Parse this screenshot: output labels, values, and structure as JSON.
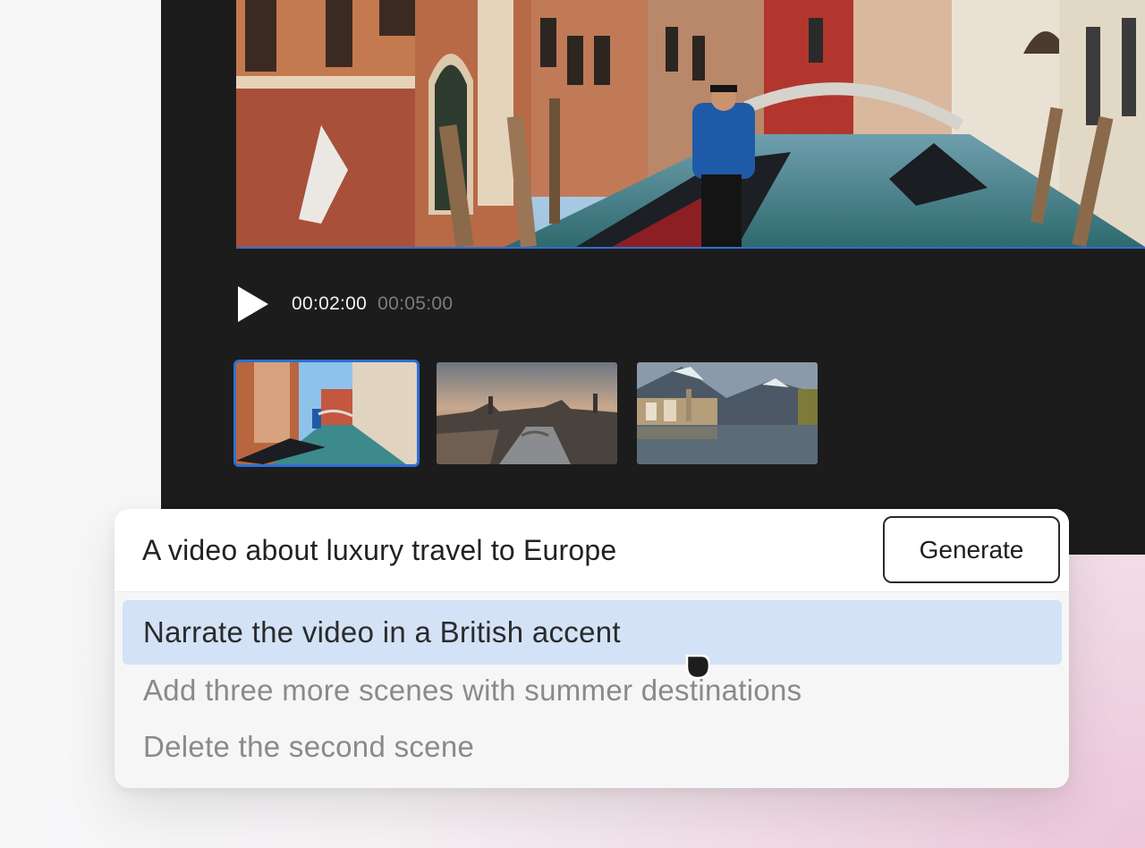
{
  "player": {
    "current_time": "00:02:00",
    "total_time": "00:05:00",
    "play_icon": "play-icon"
  },
  "scenes": [
    {
      "label": "Venice canal with gondolas",
      "selected": true
    },
    {
      "label": "European city at dusk with bridge",
      "selected": false
    },
    {
      "label": "Alpine lake village",
      "selected": false
    }
  ],
  "prompt": {
    "text": "A video about luxury travel to Europe",
    "generate_label": "Generate"
  },
  "suggestions": [
    "Narrate the video in a British accent",
    "Add three more scenes with summer destinations",
    "Delete the second scene"
  ],
  "colors": {
    "accent": "#2f6fd3",
    "highlight": "#d3e2f7",
    "editor_bg": "#1c1c1c"
  }
}
